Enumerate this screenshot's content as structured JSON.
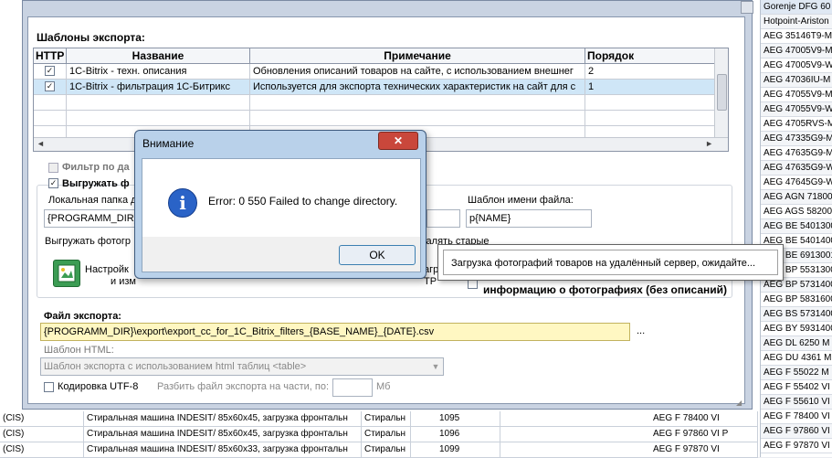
{
  "background": {
    "top_right_label": "Gorenje DFG 60",
    "right_column": [
      "Gorenje DFG 60",
      "Hotpoint-Ariston",
      "AEG 35146T9-M",
      "AEG 47005V9-M",
      "AEG 47005V9-W",
      "AEG 47036IU-M",
      "AEG 47055V9-M",
      "AEG 47055V9-W",
      "AEG 4705RVS-M",
      "AEG 47335G9-M",
      "AEG 47635G9-M",
      "AEG 47635G9-W",
      "AEG 47645G9-W",
      "AEG AGN 71800",
      "AEG AGS 58200",
      "AEG BE 5401300",
      "AEG BE 5401400",
      "AEG BE 6913001",
      "AEG BP 5531300",
      "AEG BP 5731400",
      "AEG BP 5831600",
      "AEG BS 5731400",
      "AEG BY 5931400",
      "AEG DL 6250 M",
      "AEG DU 4361 M",
      "AEG F 55022 M",
      "AEG F 55402 VI",
      "AEG F 55610 VI",
      "AEG F 78400 VI",
      "AEG F 97860 VI",
      "AEG F 97870 VI"
    ],
    "bottom_rows": [
      {
        "c1": "(CIS)",
        "c2": "Стиральная машина INDESIT/ 85x60x45, загрузка фронтальн",
        "c3": "Стиральн",
        "c4": "1095",
        "c5": "AEG F 78400 VI",
        "c6": "AEG F 78400 VI"
      },
      {
        "c1": "(CIS)",
        "c2": "Стиральная машина INDESIT/ 85x60x45, загрузка фронтальн",
        "c3": "Стиральн",
        "c4": "1096",
        "c5": "AEG F 97860 VI P",
        "c6": "AEG F 97860 VI"
      },
      {
        "c1": "(CIS)",
        "c2": "Стиральная машина INDESIT/ 85x60x33, загрузка фронтальн",
        "c3": "Стиральн",
        "c4": "1099",
        "c5": "AEG F 97870 VI",
        "c6": "AEG F 97870 VI"
      }
    ]
  },
  "export_dialog": {
    "templates_title": "Шаблоны экспорта:",
    "columns": [
      "HTTP",
      "Название",
      "Примечание",
      "Порядок"
    ],
    "rows": [
      {
        "http": true,
        "name": "1C-Bitrix - техн. описания",
        "note": "Обновления описаний товаров на сайте, с использованием внешнег",
        "order": "2",
        "selected": false
      },
      {
        "http": true,
        "name": "1C-Bitrix - фильтрация 1C-Битрикс",
        "note": "Используется для экспорта технических характеристик на сайт для с",
        "order": "1",
        "selected": true
      }
    ],
    "filter_label": "Фильтр по да",
    "upload_label": "Выгружать ф",
    "local_folder_label": "Локальная папка д",
    "local_folder_value": "{PROGRAMM_DIR}\\",
    "file_template_label": "Шаблон имени файла:",
    "file_template_value": "p{NAME}",
    "upload_photos_label": "Выгружать фотогр",
    "delete_old_label": "удалять старые",
    "settings_label_1": "Настройк",
    "settings_label_2": "и изм",
    "ftp_label_1": "загру",
    "ftp_label_2": "TP",
    "photo_info_label": "информацию о фотографиях (без описаний)",
    "export_file_label": "Файл экспорта:",
    "export_file_value": "{PROGRAMM_DIR}\\export\\export_cc_for_1C_Bitrix_filters_{BASE_NAME}_{DATE}.csv",
    "ellipsis": "...",
    "html_template_label": "Шаблон HTML:",
    "html_template_value": "Шаблон экспорта с использованием html таблиц <table>",
    "utf8_label": "Кодировка UTF-8",
    "split_label": "Разбить файл экспорта на части, по:",
    "split_unit": "Мб"
  },
  "alert": {
    "title": "Внимание",
    "close": "✕",
    "message": "Error: 0 550 Failed to change directory.",
    "ok": "OK"
  },
  "progress_popup": {
    "text": "Загрузка фотографий товаров на удалённый сервер, ожидайте..."
  },
  "colors": {
    "selection": "#cfe6f7",
    "export_file_bg": "#fff7c2",
    "alert_close": "#c9473b"
  }
}
